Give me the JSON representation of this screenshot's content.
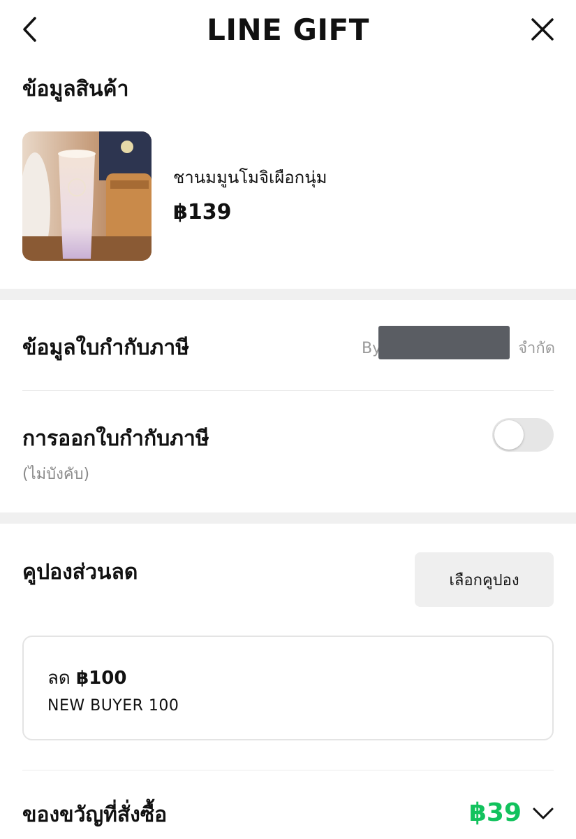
{
  "header": {
    "title": "LINE GIFT"
  },
  "product_section": {
    "title": "ข้อมูลสินค้า",
    "product_name": "ชานมมูนโมจิเผือกนุ่ม",
    "price": "฿139"
  },
  "tax_info": {
    "label": "ข้อมูลใบกำกับภาษี",
    "by_prefix": "By",
    "by_suffix": "จำกัด"
  },
  "tax_invoice": {
    "label": "การออกใบกำกับภาษี",
    "sub_label": "(ไม่บังคับ)",
    "toggle_on": false
  },
  "coupon": {
    "label": "คูปองส่วนลด",
    "select_button": "เลือกคูปอง",
    "discount_prefix": "ลด",
    "discount_amount": "฿100",
    "code": "NEW BUYER 100"
  },
  "order": {
    "label": "ของขวัญที่สั่งซื้อ",
    "total": "฿39"
  },
  "colors": {
    "accent_green": "#12c25d"
  },
  "icons": [
    "chevron-left-icon",
    "close-icon",
    "chevron-down-icon"
  ]
}
